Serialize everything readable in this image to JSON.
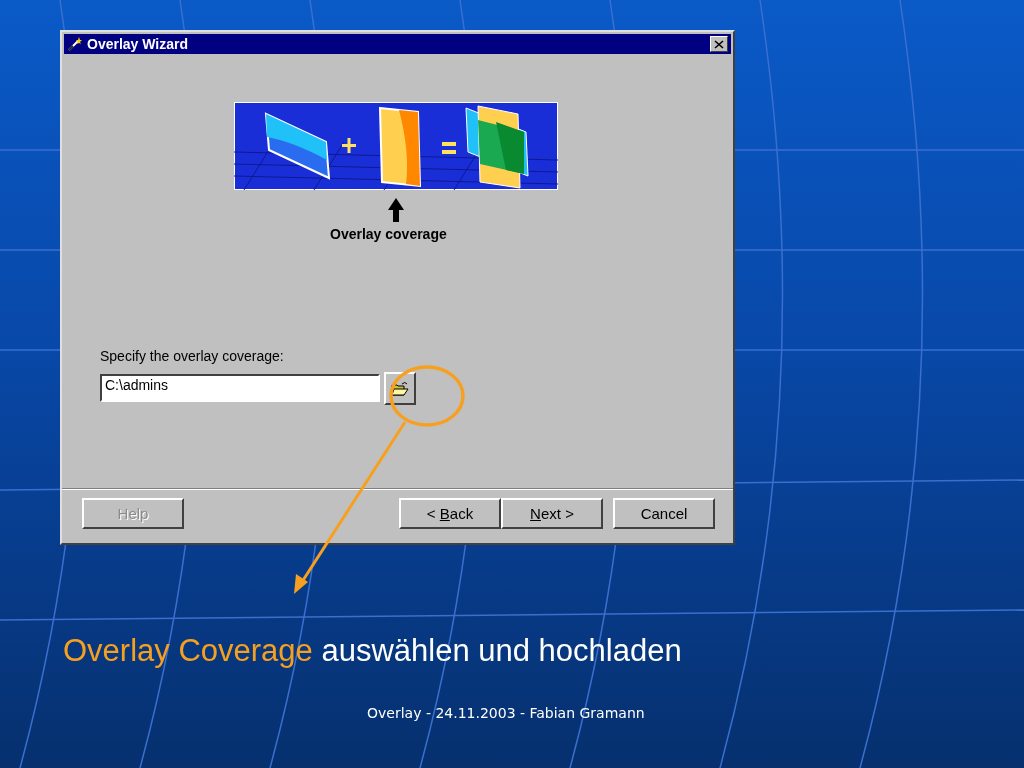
{
  "dialog": {
    "title": "Overlay Wizard",
    "caption": "Overlay coverage",
    "prompt": "Specify the overlay coverage:",
    "path_field": {
      "value": "C:\\admins"
    },
    "buttons": [
      {
        "kind": "help",
        "before": "Help",
        "disabled": true
      },
      {
        "kind": "back",
        "before": "< ",
        "key": "B",
        "after": "ack",
        "disabled": false
      },
      {
        "kind": "next",
        "key": "N",
        "after": "ext >",
        "disabled": false
      },
      {
        "kind": "cancel",
        "before": "Cancel",
        "disabled": false
      }
    ]
  },
  "slide": {
    "heading": {
      "highlight": "Overlay Coverage",
      "rest": " auswählen und hochladen"
    },
    "footer": "Overlay - 24.11.2003 - Fabian Gramann"
  }
}
